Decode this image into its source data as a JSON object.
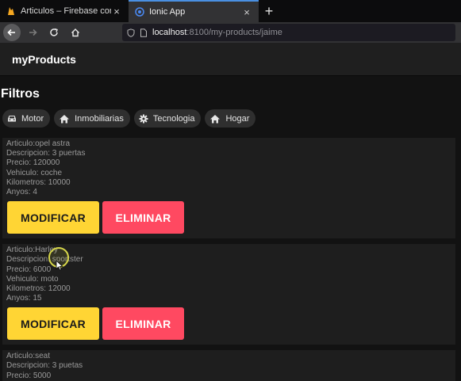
{
  "browser": {
    "tabs": [
      {
        "title": "Articulos – Firebase console",
        "close": "×"
      },
      {
        "title": "Ionic App",
        "close": "×"
      }
    ],
    "new_tab": "+",
    "url": {
      "host": "localhost",
      "path": ":8100/my-products/jaime"
    }
  },
  "app": {
    "title": "myProducts",
    "filters_title": "Filtros",
    "filters": [
      {
        "label": "Motor",
        "icon": "car-icon"
      },
      {
        "label": "Inmobiliarias",
        "icon": "home-icon"
      },
      {
        "label": "Tecnologia",
        "icon": "cog-icon"
      },
      {
        "label": "Hogar",
        "icon": "home-icon"
      }
    ],
    "products": [
      {
        "lines": [
          "Articulo:opel astra",
          "Descripcion: 3 puertas",
          "Precio: 120000",
          "Vehiculo: coche",
          "Kilometros: 10000",
          "Anyos: 4"
        ],
        "modify": "MODIFICAR",
        "delete": "ELIMINAR"
      },
      {
        "lines": [
          "Articulo:Harley",
          "Descripcion: sportster",
          "Precio: 6000",
          "Vehiculo: moto",
          "Kilometros: 12000",
          "Anyos: 15"
        ],
        "modify": "MODIFICAR",
        "delete": "ELIMINAR"
      },
      {
        "lines": [
          "Articulo:seat",
          "Descripcion: 3 puetas",
          "Precio: 5000"
        ]
      }
    ]
  },
  "colors": {
    "modify_button": "#ffd534",
    "delete_button": "#ff4961",
    "background": "#121212",
    "card": "#1e1e1e"
  }
}
